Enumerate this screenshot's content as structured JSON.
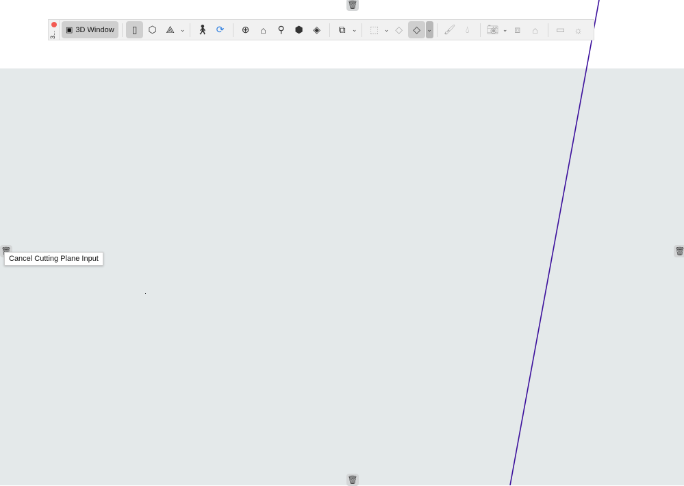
{
  "toolbar": {
    "collapsed_label": "3...",
    "window_button": {
      "label": "3D Window",
      "icon": "3d-window-icon"
    },
    "tools": [
      {
        "name": "front-view",
        "icon": "box-front-icon",
        "active": true
      },
      {
        "name": "axonometry",
        "icon": "cube-icon"
      },
      {
        "name": "orbit-axes",
        "icon": "axes-icon",
        "dropdown": true
      },
      {
        "name": "walk",
        "icon": "walk-icon"
      },
      {
        "name": "orbit",
        "icon": "orbit-icon"
      },
      {
        "name": "zoom-fit",
        "icon": "frame-icon"
      },
      {
        "name": "fit-home",
        "icon": "home-frame-icon"
      },
      {
        "name": "camera-position",
        "icon": "camera-tripod-icon"
      },
      {
        "name": "explode",
        "icon": "explode-icon"
      },
      {
        "name": "cutting-plane",
        "icon": "cutting-plane-icon"
      },
      {
        "name": "3d-view-display",
        "icon": "view-display-icon",
        "dropdown": true
      },
      {
        "name": "marquee",
        "icon": "marquee-icon",
        "dropdown": true
      },
      {
        "name": "filter",
        "icon": "filter-icon"
      },
      {
        "name": "shading",
        "icon": "shading-icon",
        "active": true,
        "dropdown": true
      },
      {
        "name": "brush",
        "icon": "brush-icon"
      },
      {
        "name": "paint-drop",
        "icon": "paint-drop-icon"
      },
      {
        "name": "snapshot",
        "icon": "camera-icon",
        "dropdown": true
      },
      {
        "name": "render-view",
        "icon": "render-icon"
      },
      {
        "name": "section-home",
        "icon": "section-home-icon"
      },
      {
        "name": "video",
        "icon": "video-icon"
      },
      {
        "name": "sun",
        "icon": "sun-icon"
      }
    ]
  },
  "tooltip": "Cancel Cutting Plane Input",
  "colors": {
    "canvas": "#e4e9ea",
    "line": "#3b0f9c",
    "accent": "#2a7de1"
  }
}
